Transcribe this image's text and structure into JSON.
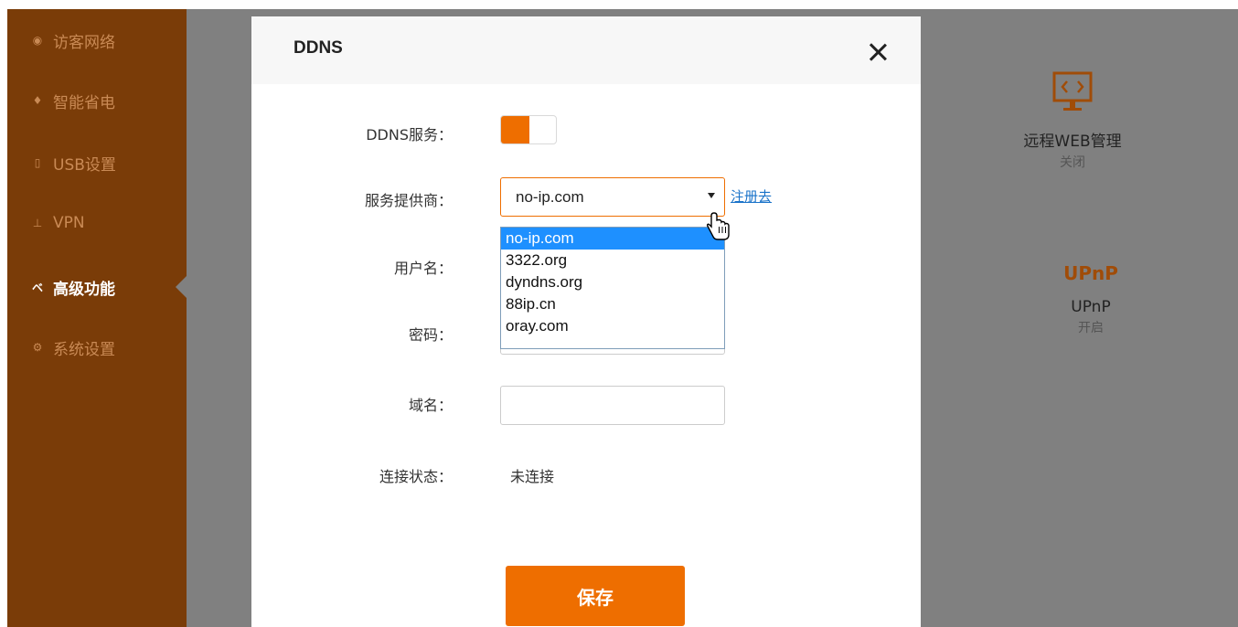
{
  "sidebar": {
    "items": [
      {
        "label": "访客网络",
        "icon": "guest-network-icon",
        "active": false
      },
      {
        "label": "智能省电",
        "icon": "power-saving-icon",
        "active": false
      },
      {
        "label": "USB设置",
        "icon": "usb-icon",
        "active": false
      },
      {
        "label": "VPN",
        "icon": "vpn-icon",
        "active": false
      },
      {
        "label": "高级功能",
        "icon": "wrench-icon",
        "active": true
      },
      {
        "label": "系统设置",
        "icon": "settings-icon",
        "active": false
      }
    ]
  },
  "background_cards": [
    {
      "title": "远程WEB管理",
      "status": "关闭",
      "icon": "monitor-code-icon"
    },
    {
      "title": "UPnP",
      "status": "开启",
      "icon": "upnp-logo-icon",
      "logo_text": "UPnP"
    }
  ],
  "modal": {
    "title": "DDNS",
    "fields": {
      "service_label": "DDNS服务：",
      "service_enabled": true,
      "provider_label": "服务提供商：",
      "provider_selected": "no-ip.com",
      "provider_options": [
        "no-ip.com",
        "3322.org",
        "dyndns.org",
        "88ip.cn",
        "oray.com"
      ],
      "register_link": "注册去",
      "username_label": "用户名：",
      "password_label": "密码：",
      "domain_label": "域名：",
      "status_label": "连接状态：",
      "status_value": "未连接"
    },
    "save_label": "保存"
  },
  "colors": {
    "accent": "#ee6e00",
    "sidebar_bg": "#7a3c08",
    "overlay": "#808080",
    "link": "#1a73c9",
    "option_selected_bg": "#1e90ff"
  }
}
